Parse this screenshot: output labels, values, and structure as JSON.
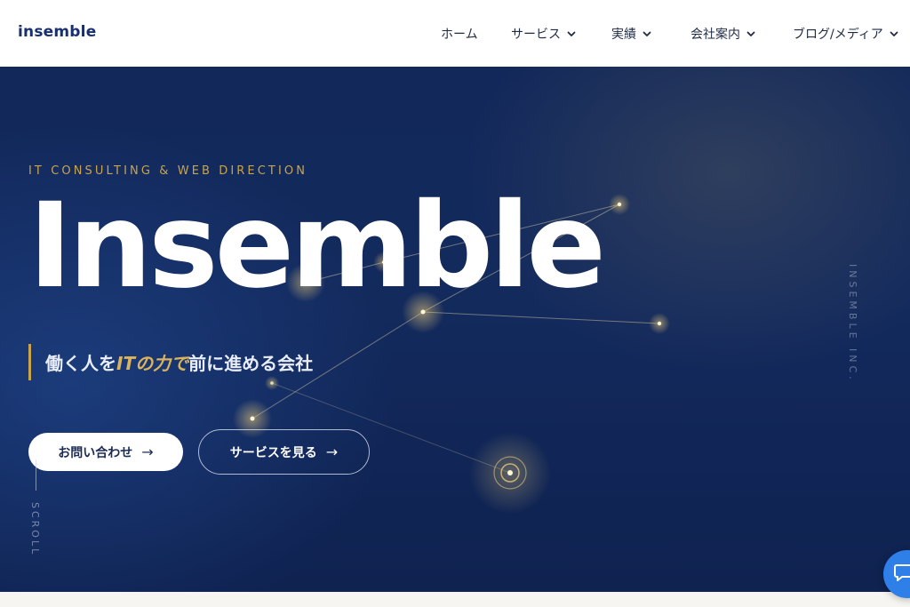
{
  "header": {
    "logo": "insemble",
    "nav": [
      {
        "label": "ホーム",
        "dropdown": false
      },
      {
        "label": "サービス",
        "dropdown": true
      },
      {
        "label": "実績",
        "dropdown": true
      },
      {
        "label": "会社案内",
        "dropdown": true
      },
      {
        "label": "ブログ/メディア",
        "dropdown": true
      }
    ]
  },
  "hero": {
    "tagline": "IT CONSULTING & WEB DIRECTION",
    "title": "Insemble",
    "subcopy_before": "働く人を",
    "subcopy_accent": "ITの力で",
    "subcopy_after": "前に進める会社",
    "contact_button": "お問い合わせ",
    "service_button": "サービスを見る",
    "arrow": "→",
    "scroll_label": "SCROLL",
    "vertical_brand": "INSEMBLE INC."
  },
  "icons": {
    "chevron": "chevron-down-icon",
    "chat": "chat-bubble-icon"
  },
  "colors": {
    "brand_navy": "#1a2f6e",
    "hero_background": "#12285a",
    "accent_gold": "#c9a44c",
    "chat_blue": "#2f7fe8"
  }
}
